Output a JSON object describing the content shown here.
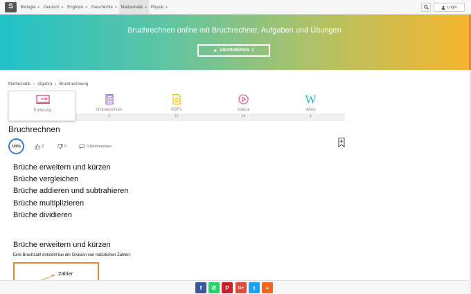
{
  "nav": {
    "logo_letter": "S",
    "items": [
      {
        "label": "Biologie"
      },
      {
        "label": "Deutsch"
      },
      {
        "label": "Englisch"
      },
      {
        "label": "Geschichte"
      },
      {
        "label": "Mathematik",
        "active": true
      },
      {
        "label": "Physik"
      }
    ],
    "login_label": "Login"
  },
  "hero": {
    "title": "Bruchrechnen online mit Bruchrechner, Aufgaben und Übungen",
    "subscribe_label": "ABONNIEREN",
    "subscribe_count": "1"
  },
  "breadcrumb": [
    "Mathematik",
    "Algebra",
    "Bruchrechnung"
  ],
  "tabs": [
    {
      "label": "Erklärung",
      "count": "",
      "icon": "presentation-icon",
      "color": "#e0457b"
    },
    {
      "label": "Onlinerechner",
      "count": "3",
      "icon": "calculator-icon",
      "color": "#8e5cc7"
    },
    {
      "label": "PDFs",
      "count": "12",
      "icon": "document-icon",
      "color": "#f0b400"
    },
    {
      "label": "Videos",
      "count": "14",
      "icon": "play-icon",
      "color": "#e0457b"
    },
    {
      "label": "Wikis",
      "count": "1",
      "icon": "wiki-icon",
      "color": "#1fb5b5"
    }
  ],
  "article": {
    "title": "Bruchrechnen",
    "rating": "100%",
    "likes": "2",
    "dislikes": "0",
    "comments": "0 Kommentare",
    "toc": [
      "Brüche erweitern und kürzen",
      "Brüche vergleichen",
      "Brüche addieren und subtrahieren",
      "Brüche multiplizieren",
      "Brüche dividieren"
    ],
    "section_title": "Brüche erweitern und kürzen",
    "section_text": "Eine Bruchzahl entsteht bei der Division von natürlichen Zahlen:",
    "figure_label": "Zähler"
  },
  "share": [
    {
      "glyph": "f",
      "icon": "facebook-icon",
      "color": "#3b5998"
    },
    {
      "glyph": "✆",
      "icon": "whatsapp-icon",
      "color": "#25d366"
    },
    {
      "glyph": "P",
      "icon": "pinterest-icon",
      "color": "#cb2027"
    },
    {
      "glyph": "G+",
      "icon": "googleplus-icon",
      "color": "#dd4b39"
    },
    {
      "glyph": "t",
      "icon": "twitter-icon",
      "color": "#1da1f2"
    },
    {
      "glyph": "+",
      "icon": "more-share-icon",
      "color": "#f26522"
    }
  ],
  "colors": {
    "accent": "#e0873a",
    "rating_ring": "#3d7cc9"
  }
}
